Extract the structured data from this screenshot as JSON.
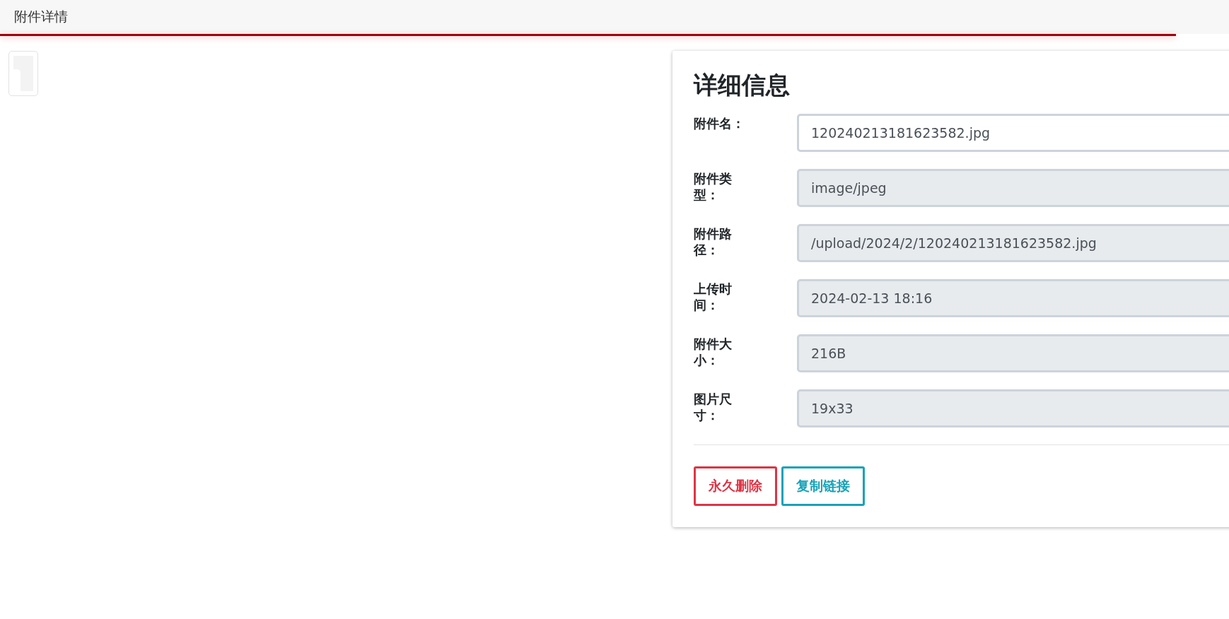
{
  "header": {
    "title": "附件详情"
  },
  "loading_bar": {
    "level": 0.957
  },
  "details": {
    "title": "详细信息",
    "fields": [
      {
        "label": "附件名：",
        "value": "120240213181623582.jpg",
        "disabled": false
      },
      {
        "label": "附件类型：",
        "value": "image/jpeg",
        "disabled": true
      },
      {
        "label": "附件路径：",
        "value": "/upload/2024/2/120240213181623582.jpg",
        "disabled": true
      },
      {
        "label": "上传时间：",
        "value": "2024-02-13 18:16",
        "disabled": true
      },
      {
        "label": "附件大小：",
        "value": "216B",
        "disabled": true
      },
      {
        "label": "图片尺寸：",
        "value": "19x33",
        "disabled": true
      }
    ],
    "buttons": [
      {
        "label": "永久删除",
        "kind": "danger"
      },
      {
        "label": "复制链接",
        "kind": "info"
      }
    ]
  }
}
